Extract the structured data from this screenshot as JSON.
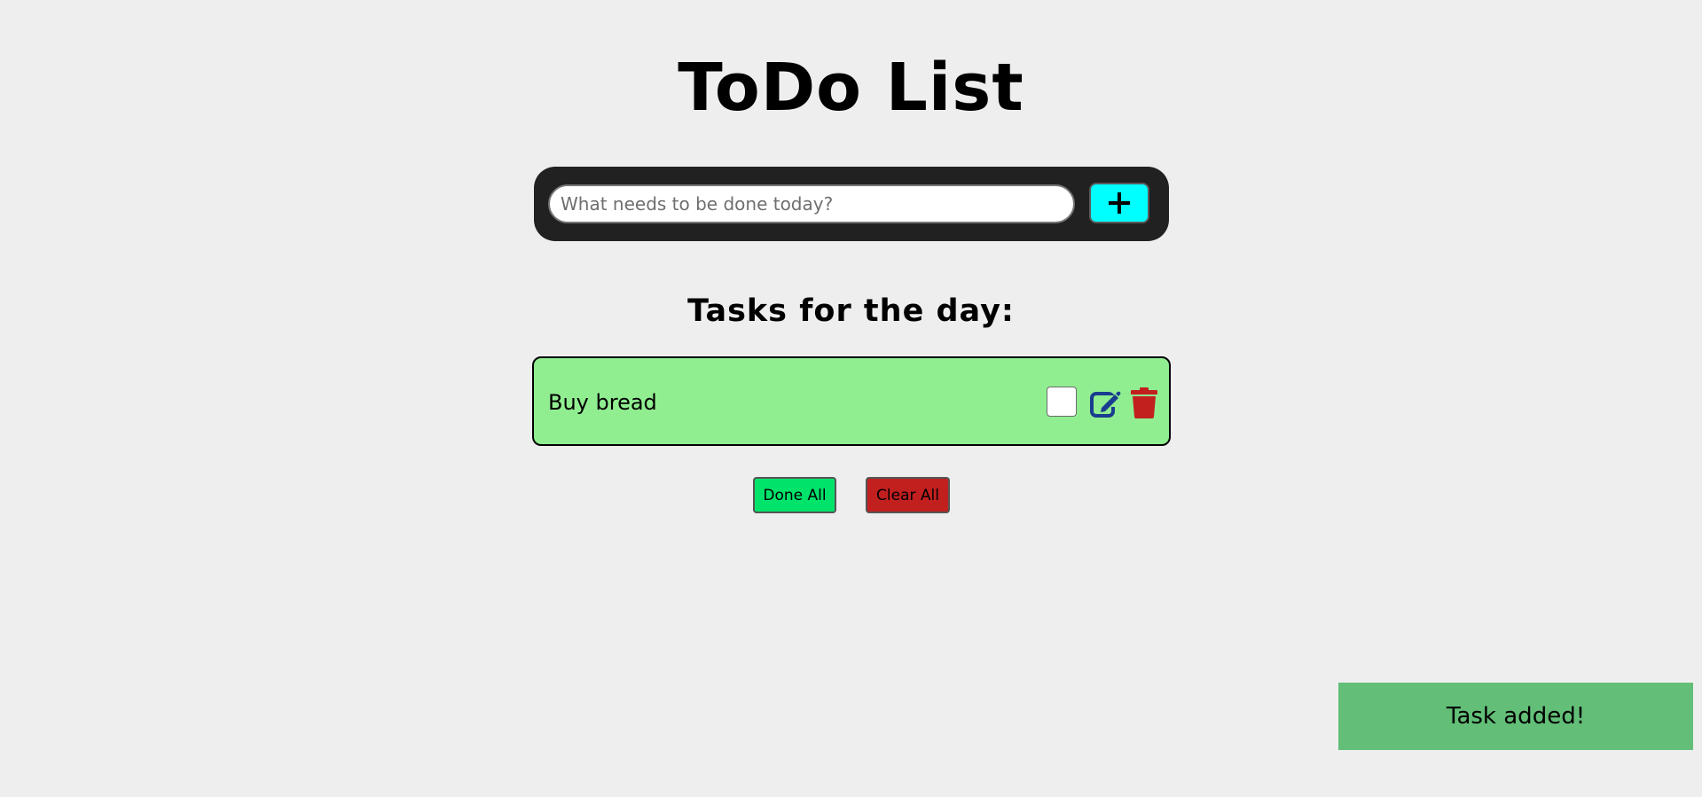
{
  "header": {
    "title": "ToDo List"
  },
  "input_bar": {
    "placeholder": "What needs to be done today?",
    "value": "",
    "add_icon": "plus-icon"
  },
  "tasks": {
    "heading": "Tasks for the day:",
    "items": [
      {
        "text": "Buy bread",
        "done": false,
        "edit_icon": "pen-to-square-icon",
        "delete_icon": "trash-icon"
      }
    ]
  },
  "actions": {
    "done_all_label": "Done All",
    "clear_all_label": "Clear All"
  },
  "toast": {
    "message": "Task added!"
  },
  "colors": {
    "background": "#eeeeee",
    "input_bar": "#212121",
    "add_button": "#00ffff",
    "task_item": "#90ee90",
    "edit_icon": "#1a3d8f",
    "delete_icon": "#c21f1f",
    "done_all_button": "#00e36b",
    "clear_all_button": "#c21f1f",
    "toast": "#63bf78"
  }
}
